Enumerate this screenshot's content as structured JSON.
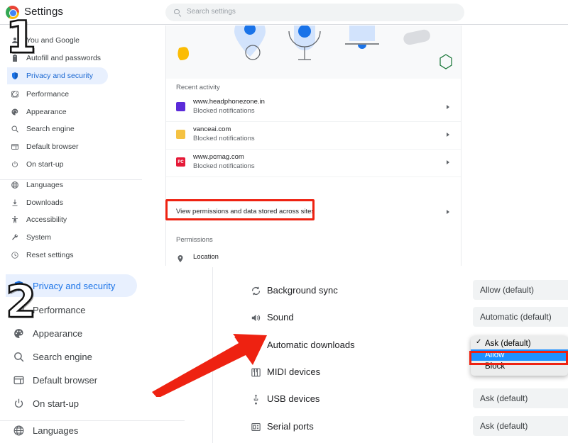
{
  "app": {
    "name": "Settings",
    "logo_icon": "chrome-logo-icon"
  },
  "search": {
    "placeholder": "Search settings",
    "value": "",
    "icon": "search-icon"
  },
  "panel1": {
    "sidebar": [
      {
        "label": "You and Google",
        "icon": "person-icon",
        "selected": false
      },
      {
        "label": "Autofill and passwords",
        "icon": "clipboard-icon",
        "selected": false
      },
      {
        "label": "Privacy and security",
        "icon": "shield-icon",
        "selected": true
      },
      {
        "label": "Performance",
        "icon": "speedometer-icon",
        "selected": false
      },
      {
        "label": "Appearance",
        "icon": "palette-icon",
        "selected": false
      },
      {
        "label": "Search engine",
        "icon": "search-icon",
        "selected": false
      },
      {
        "label": "Default browser",
        "icon": "browser-window-icon",
        "selected": false
      },
      {
        "label": "On start-up",
        "icon": "power-icon",
        "selected": false
      },
      {
        "label": "Languages",
        "icon": "globe-icon",
        "selected": false
      },
      {
        "label": "Downloads",
        "icon": "download-icon",
        "selected": false
      },
      {
        "label": "Accessibility",
        "icon": "accessibility-icon",
        "selected": false
      },
      {
        "label": "System",
        "icon": "wrench-icon",
        "selected": false
      },
      {
        "label": "Reset settings",
        "icon": "restore-icon",
        "selected": false
      }
    ],
    "recent_activity": {
      "heading": "Recent activity",
      "items": [
        {
          "site": "www.headphonezone.in",
          "status": "Blocked notifications",
          "favicon_color": "#5b2bd9",
          "favicon_text": ""
        },
        {
          "site": "vanceai.com",
          "status": "Blocked notifications",
          "favicon_color": "#f5c242",
          "favicon_text": ""
        },
        {
          "site": "www.pcmag.com",
          "status": "Blocked notifications",
          "favicon_color": "#e51937",
          "favicon_text": "PC"
        }
      ],
      "view_all_label": "View permissions and data stored across sites"
    },
    "permissions_heading": "Permissions",
    "first_permission": {
      "label": "Location",
      "icon": "location-pin-icon"
    }
  },
  "panel2": {
    "sidebar": [
      {
        "label": "Privacy and security",
        "icon": "shield-icon",
        "selected": true
      },
      {
        "label": "Performance",
        "icon": "speedometer-icon",
        "selected": false
      },
      {
        "label": "Appearance",
        "icon": "palette-icon",
        "selected": false
      },
      {
        "label": "Search engine",
        "icon": "search-icon",
        "selected": false
      },
      {
        "label": "Default browser",
        "icon": "browser-window-icon",
        "selected": false
      },
      {
        "label": "On start-up",
        "icon": "power-icon",
        "selected": false
      },
      {
        "label": "Languages",
        "icon": "globe-icon",
        "selected": false
      }
    ],
    "permissions": [
      {
        "label": "Background sync",
        "icon": "sync-icon",
        "value": "Allow (default)"
      },
      {
        "label": "Sound",
        "icon": "speaker-icon",
        "value": "Automatic (default)"
      },
      {
        "label": "Automatic downloads",
        "icon": "download-icon",
        "value": ""
      },
      {
        "label": "MIDI devices",
        "icon": "piano-icon",
        "value": ""
      },
      {
        "label": "USB devices",
        "icon": "usb-icon",
        "value": "Ask (default)"
      },
      {
        "label": "Serial ports",
        "icon": "serial-port-icon",
        "value": "Ask (default)"
      }
    ],
    "dropdown": {
      "open": true,
      "options": [
        {
          "label": "Ask (default)",
          "checked": true,
          "highlighted": false
        },
        {
          "label": "Allow",
          "checked": false,
          "highlighted": true
        },
        {
          "label": "Block",
          "checked": false,
          "highlighted": false
        }
      ]
    }
  },
  "annotations": {
    "marker_one": "1",
    "marker_two": "2",
    "highlight_color": "#ee2211",
    "arrow_color": "#ee2211",
    "selection_color": "#1e90ff"
  }
}
